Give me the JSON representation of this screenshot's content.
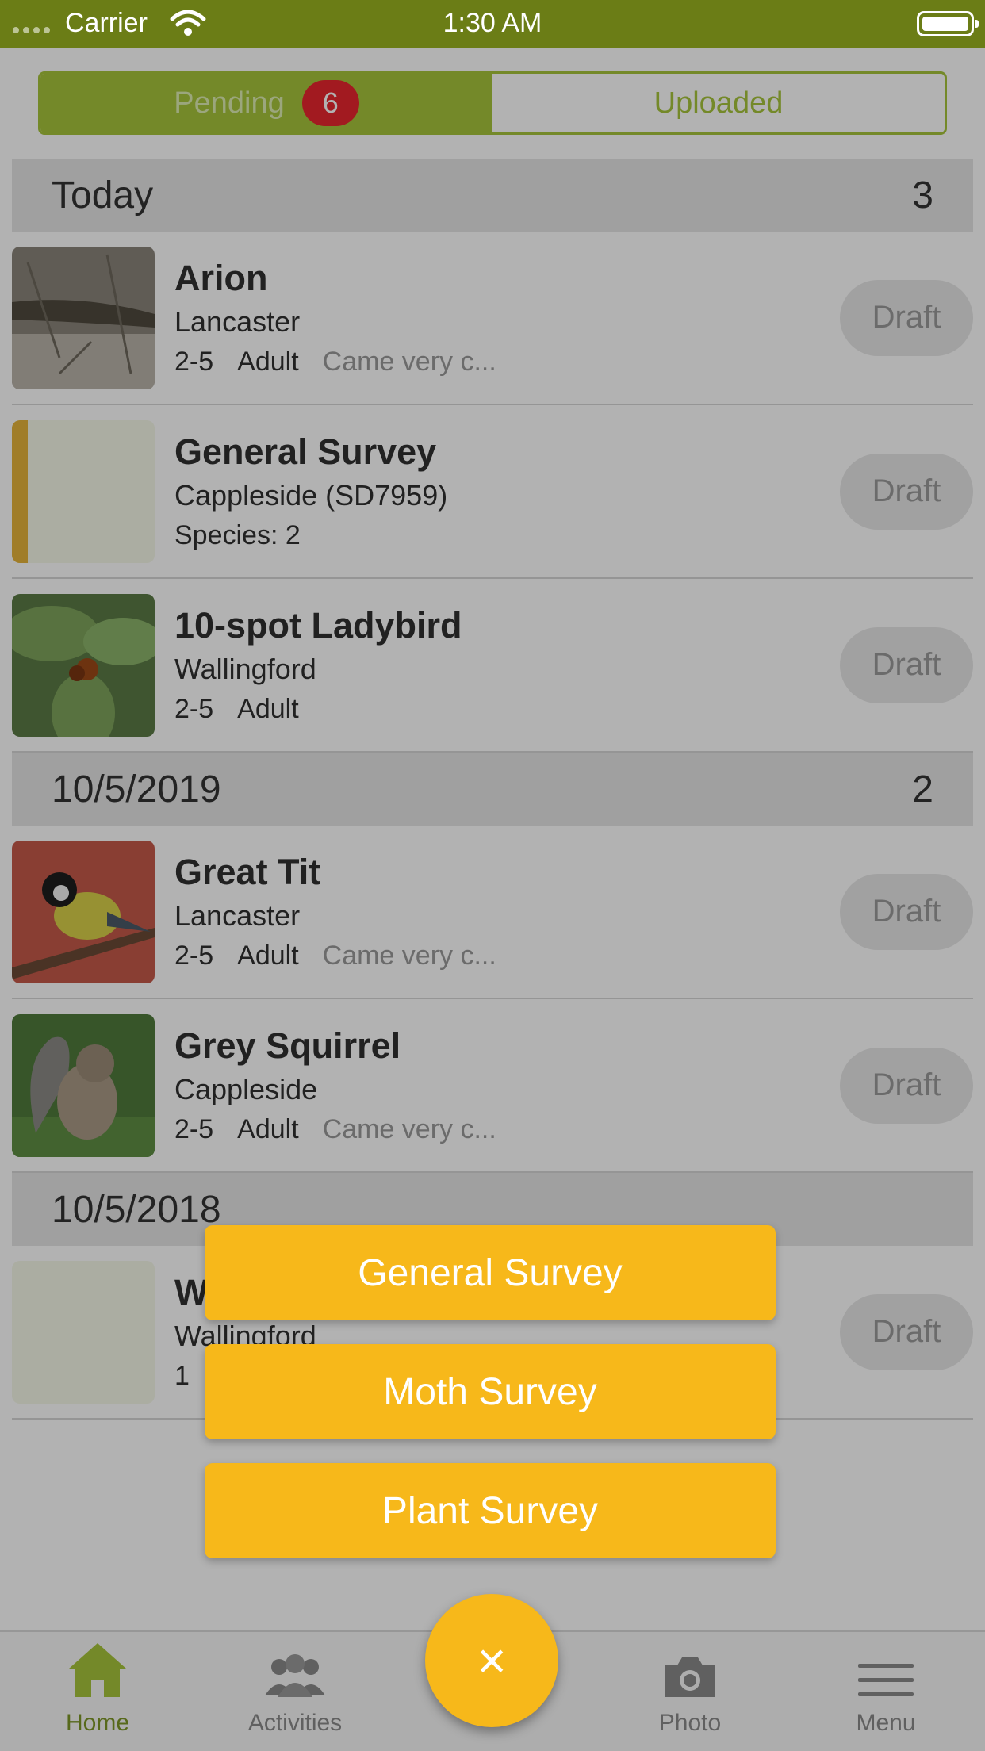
{
  "status_bar": {
    "carrier": "Carrier",
    "time": "1:30 AM"
  },
  "segments": {
    "pending_label": "Pending",
    "pending_count": "6",
    "uploaded_label": "Uploaded"
  },
  "sections": [
    {
      "label": "Today",
      "count": "3",
      "rows": [
        {
          "title": "Arion",
          "location": "Lancaster",
          "number": "2-5",
          "stage": "Adult",
          "comment": "Came very c...",
          "status": "Draft",
          "thumb_icon": "slug-photo"
        },
        {
          "title": "General Survey",
          "location": "Cappleside (SD7959)",
          "summary": "Species: 2",
          "status": "Draft",
          "thumb_icon": "survey-placeholder"
        },
        {
          "title": "10-spot Ladybird",
          "location": "Wallingford",
          "number": "2-5",
          "stage": "Adult",
          "status": "Draft",
          "thumb_icon": "ladybird-photo"
        }
      ]
    },
    {
      "label": "10/5/2019",
      "count": "2",
      "rows": [
        {
          "title": "Great Tit",
          "location": "Lancaster",
          "number": "2-5",
          "stage": "Adult",
          "comment": "Came very c...",
          "status": "Draft",
          "thumb_icon": "bird-photo"
        },
        {
          "title": "Grey Squirrel",
          "location": "Cappleside",
          "number": "2-5",
          "stage": "Adult",
          "comment": "Came very c...",
          "status": "Draft",
          "thumb_icon": "squirrel-photo"
        }
      ]
    },
    {
      "label": "10/5/2018",
      "rows": [
        {
          "title": "W",
          "location": "Wallingford",
          "number": "1",
          "status": "Draft",
          "thumb_icon": "empty-placeholder"
        }
      ]
    }
  ],
  "popup_menu": {
    "general": "General Survey",
    "moth": "Moth Survey",
    "plant": "Plant Survey"
  },
  "fab": {
    "label": "×"
  },
  "tabs": {
    "home": "Home",
    "activities": "Activities",
    "photo": "Photo",
    "menu": "Menu"
  },
  "colors": {
    "brand_green": "#6b7d16",
    "accent_green": "#a7c43b",
    "accent_yellow": "#f7b81a",
    "badge_red": "#e8262e"
  }
}
